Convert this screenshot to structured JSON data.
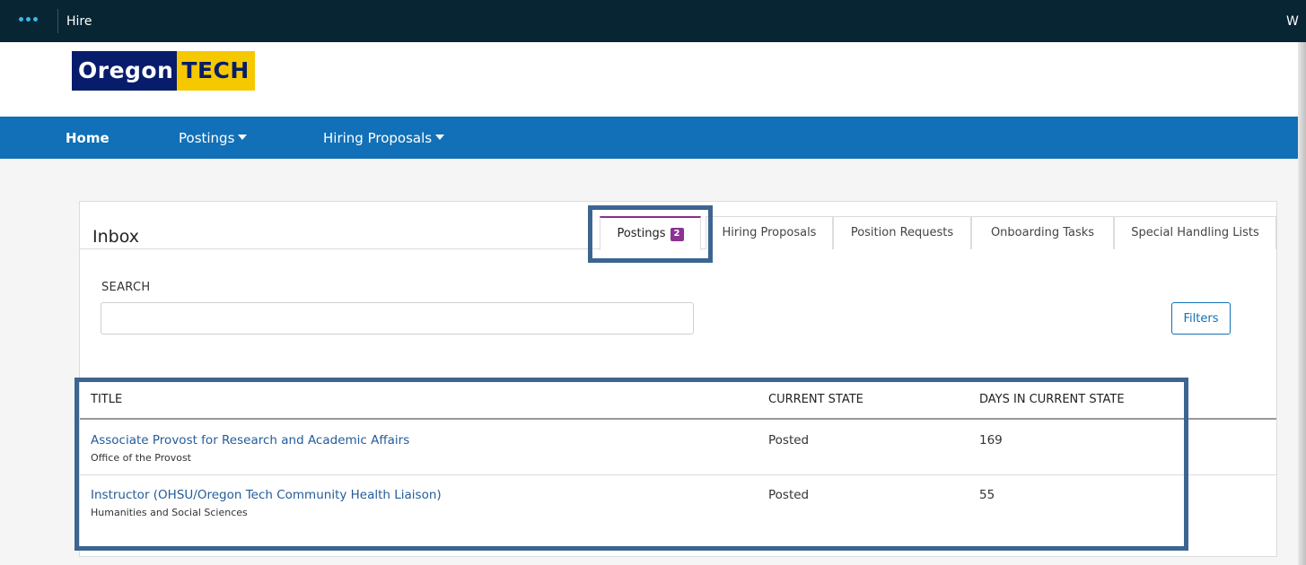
{
  "topbar": {
    "app_name": "Hire",
    "user_initial": "W",
    "menu_icon": "dots-menu-icon"
  },
  "logo": {
    "part1": "Oregon",
    "part2": "TECH",
    "colors": {
      "navy": "#071d6b",
      "gold": "#f5c800"
    }
  },
  "nav": {
    "items": [
      {
        "label": "Home",
        "active": true
      },
      {
        "label": "Postings",
        "dropdown": true
      },
      {
        "label": "Hiring Proposals",
        "dropdown": true
      }
    ],
    "color": "#1170b7"
  },
  "inbox": {
    "title": "Inbox",
    "tabs": [
      {
        "label": "Postings",
        "badge": "2",
        "active": true
      },
      {
        "label": "Hiring Proposals"
      },
      {
        "label": "Position Requests"
      },
      {
        "label": "Onboarding Tasks"
      },
      {
        "label": "Special Handling Lists"
      }
    ],
    "search": {
      "label": "SEARCH",
      "value": "",
      "placeholder": ""
    },
    "filters_label": "Filters",
    "table": {
      "columns": [
        "TITLE",
        "CURRENT STATE",
        "DAYS IN CURRENT STATE"
      ],
      "rows": [
        {
          "title": "Associate Provost for Research and Academic Affairs",
          "department": "Office of the Provost",
          "state": "Posted",
          "days": "169"
        },
        {
          "title": "Instructor (OHSU/Oregon Tech Community Health Liaison)",
          "department": "Humanities and Social Sciences",
          "state": "Posted",
          "days": "55"
        }
      ]
    }
  },
  "highlight_color": "#3c6590"
}
